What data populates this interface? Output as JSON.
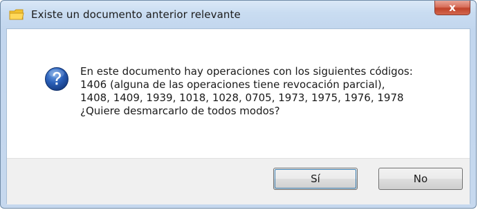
{
  "window": {
    "title": "Existe un documento anterior relevante",
    "app_icon": "folder-icon",
    "close_label": "x"
  },
  "message": {
    "icon": "question-icon",
    "lines": [
      "En este documento hay operaciones con los siguientes códigos:",
      "1406 (alguna de las operaciones tiene revocación parcial),",
      "1408, 1409, 1939, 1018, 1028, 0705, 1973, 1975, 1976, 1978",
      "¿Quiere desmarcarlo de todos modos?"
    ]
  },
  "buttons": {
    "yes_label": "Sí",
    "no_label": "No"
  },
  "colors": {
    "titlebar": "#c6d8ee",
    "close_button": "#c0432b",
    "question_icon": "#1f4f9e",
    "button_bar": "#f0f0f0"
  }
}
